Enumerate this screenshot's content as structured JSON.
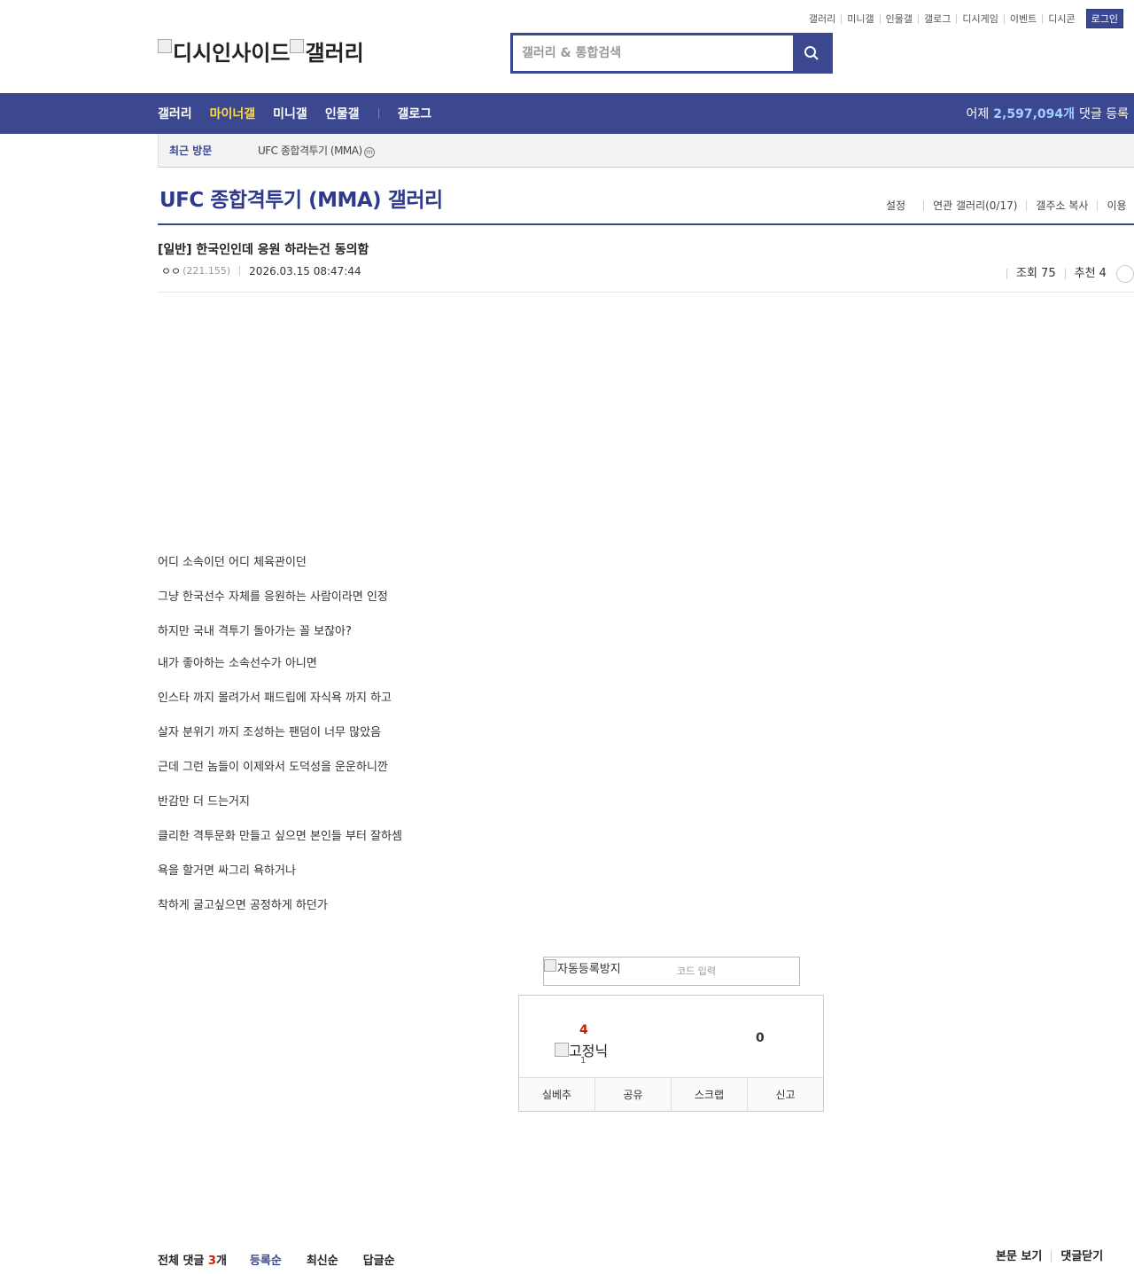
{
  "toplinks": [
    "갤러리",
    "미니갤",
    "인물갤",
    "갤로그",
    "디시게임",
    "이벤트",
    "디시콘"
  ],
  "login_label": "로그인",
  "logo": {
    "site_alt": "디시인사이드",
    "gallery_alt": "갤러리"
  },
  "search": {
    "placeholder": "갤러리 & 통합검색"
  },
  "nav": {
    "items": [
      {
        "label": "갤러리",
        "active": false
      },
      {
        "label": "마이너갤",
        "active": true
      },
      {
        "label": "미니갤",
        "active": false
      },
      {
        "label": "인물갤",
        "active": false
      }
    ],
    "gallog": "갤로그",
    "stat_prefix": "어제",
    "stat_count": "2,597,094개",
    "stat_suffix": "댓글 등록"
  },
  "recent": {
    "label": "최근 방문",
    "item": "UFC 종합격투기 (MMA)",
    "badge": "m"
  },
  "gallery": {
    "title": "UFC 종합격투기 (MMA) 갤러리",
    "options": [
      "설정",
      "연관 갤러리(0/17)",
      "갤주소 복사",
      "이용"
    ]
  },
  "post": {
    "title": "[일반] 한국인인데 응원 하라는건 동의함",
    "author": "ㅇㅇ",
    "ip": "(221.155)",
    "date": "2026.03.15 08:47:44",
    "views": "조회 75",
    "recommends": "추천 4",
    "body": [
      "어디 소속이던 어디 체육관이던",
      "그냥 한국선수 자체를 응원하는 사람이라면 인정",
      "하지만 국내 격투기 돌아가는 꼴 보잖아?",
      "내가 좋아하는 소속선수가 아니면",
      "인스타 까지 몰려가서 패드립에 자식욕 까지 하고",
      "살자 분위기 까지 조성하는 팬덤이 너무 많았음",
      "근데 그런 놈들이 이제와서 도덕성을 운운하니깐",
      "반감만 더 드는거지",
      "클리한 격투문화 만들고 싶으면 본인들 부터 잘하셈",
      "욕을 할거면 싸그리 욕하거나",
      "착하게 굴고싶으면 공정하게 하던가"
    ]
  },
  "captcha": {
    "img_alt": "자동등록방지",
    "placeholder": "코드 입력"
  },
  "recommend": {
    "up": "4",
    "fixnick_alt": "고정닉",
    "fixnick_count": "1",
    "down": "0",
    "actions": [
      "실베추",
      "공유",
      "스크랩",
      "신고"
    ]
  },
  "comments": {
    "total_label": "전체 댓글",
    "total_count": "3",
    "total_unit": "개",
    "sorts": [
      "등록순",
      "최신순",
      "답글순"
    ],
    "right": [
      "본문 보기",
      "댓글닫기"
    ]
  }
}
